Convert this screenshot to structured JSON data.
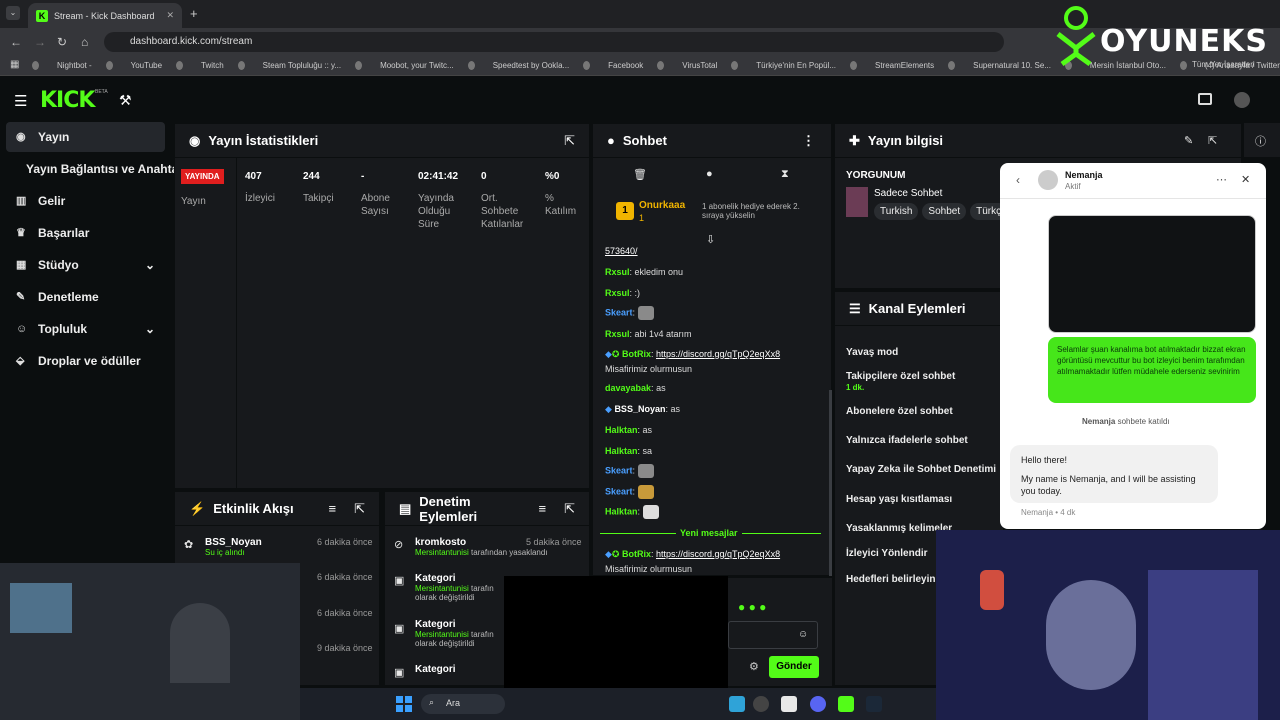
{
  "browser": {
    "tab_title": "Stream - Kick Dashboard",
    "url": "dashboard.kick.com/stream",
    "bookmarks": [
      "Nightbot -",
      "YouTube",
      "Twitch",
      "Steam Topluluğu :: y...",
      "Moobot, your Twitc...",
      "Speedtest by Ookla...",
      "Facebook",
      "VirusTotal",
      "Türkiye'nin En Popül...",
      "StreamElements",
      "Supernatural 10. Se...",
      "Mersin İstanbul Oto...",
      "(4) Anasayfa / Twitter"
    ],
    "bookmarks_all": "Tüm Yer İşaretleri"
  },
  "watermark": "OYUNEKS",
  "kick": {
    "logo": "KICK",
    "beta": "BETA"
  },
  "sidebar": {
    "items": [
      {
        "label": "Yayın",
        "active": true
      },
      {
        "label": "Yayın Bağlantısı ve Anahtarı"
      },
      {
        "label": "Gelir"
      },
      {
        "label": "Başarılar"
      },
      {
        "label": "Stüdyo"
      },
      {
        "label": "Denetleme"
      },
      {
        "label": "Topluluk"
      },
      {
        "label": "Droplar ve ödüller"
      }
    ]
  },
  "stats": {
    "title": "Yayın İstatistikleri",
    "live": "YAYINDA",
    "live_label": "Yayın",
    "items": [
      {
        "value": "407",
        "label": "İzleyici"
      },
      {
        "value": "244",
        "label": "Takipçi"
      },
      {
        "value": "-",
        "label": "Abone Sayısı"
      },
      {
        "value": "02:41:42",
        "label": "Yayında Olduğu Süre"
      },
      {
        "value": "0",
        "label": "Ort. Sohbete Katılanlar"
      },
      {
        "value": "%0",
        "label": "% Katılım"
      }
    ]
  },
  "chat": {
    "title": "Sohbet",
    "pinned_user": "Onurkaaa",
    "pinned_count": "1",
    "pinned_text": "1 abonelik hediye ederek 2. sıraya yükselin",
    "pinned_badge": "1",
    "lines": [
      {
        "user": "",
        "text": "573640/"
      },
      {
        "user": "Rxsul",
        "text": "ekledim onu"
      },
      {
        "user": "Rxsul",
        "text": ":)"
      },
      {
        "user": "Skeart",
        "text": ""
      },
      {
        "user": "Rxsul",
        "text": "abi 1v4 atarım"
      },
      {
        "user": "BotRix",
        "text": "https://discord.gg/qTpQ2eqXx8"
      },
      {
        "user": "",
        "text": "Misafirimiz olurmusun"
      },
      {
        "user": "davayabak",
        "text": "as"
      },
      {
        "user": "BSS_Noyan",
        "text": "as"
      },
      {
        "user": "Halktan",
        "text": "as"
      },
      {
        "user": "Halktan",
        "text": "sa"
      },
      {
        "user": "Skeart",
        "text": ""
      },
      {
        "user": "Skeart",
        "text": ""
      },
      {
        "user": "Halktan",
        "text": ""
      }
    ],
    "new_messages": "Yeni mesajlar",
    "after_user": "BotRix",
    "after_link": "https://discord.gg/qTpQ2eqXx8",
    "after_text": "Misafirimiz olurmusun",
    "send": "Gönder"
  },
  "info": {
    "title": "Yayın bilgisi",
    "stream_title": "YORGUNUM",
    "category": "Sadece Sohbet",
    "tags": [
      "Turkish",
      "Sohbet",
      "Türkç"
    ]
  },
  "actions": {
    "title": "Kanal Eylemleri",
    "items": [
      "Yavaş mod",
      "Takipçilere özel sohbet",
      "Abonelere özel sohbet",
      "Yalnızca ifadelerle sohbet",
      "Yapay Zeka ile Sohbet Denetimi",
      "Hesap yaşı kısıtlaması",
      "Yasaklanmış kelimeler",
      "İzleyici Yönlendir",
      "Hedefleri belirleyin"
    ],
    "follower_sub": "1 dk."
  },
  "feed": {
    "title": "Etkinlik Akışı",
    "rows": [
      {
        "user": "BSS_Noyan",
        "sub": "Su iç alındı",
        "time": "6 dakika önce"
      },
      {
        "time": "6 dakika önce"
      },
      {
        "time": "6 dakika önce"
      },
      {
        "time": "9 dakika önce"
      }
    ]
  },
  "mod": {
    "title": "Denetim Eylemleri",
    "rows": [
      {
        "user": "kromkosto",
        "sub": "Mersintantunisi",
        "sub2": "tarafından yasaklandı",
        "time": "5 dakika önce"
      },
      {
        "user": "Kategori",
        "sub": "Mersintantunisi",
        "sub2": "tarafın",
        "sub3": "olarak değiştirildi"
      },
      {
        "user": "Kategori",
        "sub": "Mersintantunisi",
        "sub2": "tarafın",
        "sub3": "olarak değiştirildi"
      },
      {
        "user": "Kategori"
      }
    ]
  },
  "messenger": {
    "name": "Nemanja",
    "status": "Aktif",
    "user_msg": "Selamlar şuan kanalıma bot atılmaktadır bizzat ekran görüntüsü mevcuttur bu bot izleyici benim tarafımdan atılmamaktadır lütfen müdahele ederseniz sevinirim",
    "joined_name": "Nemanja",
    "joined": "sohbete katıldı",
    "reply1": "Hello there!",
    "reply2": "My name is Nemanja, and I will be assisting you today.",
    "meta": "Nemanja • 4 dk"
  },
  "taskbar": {
    "search": "Ara"
  }
}
